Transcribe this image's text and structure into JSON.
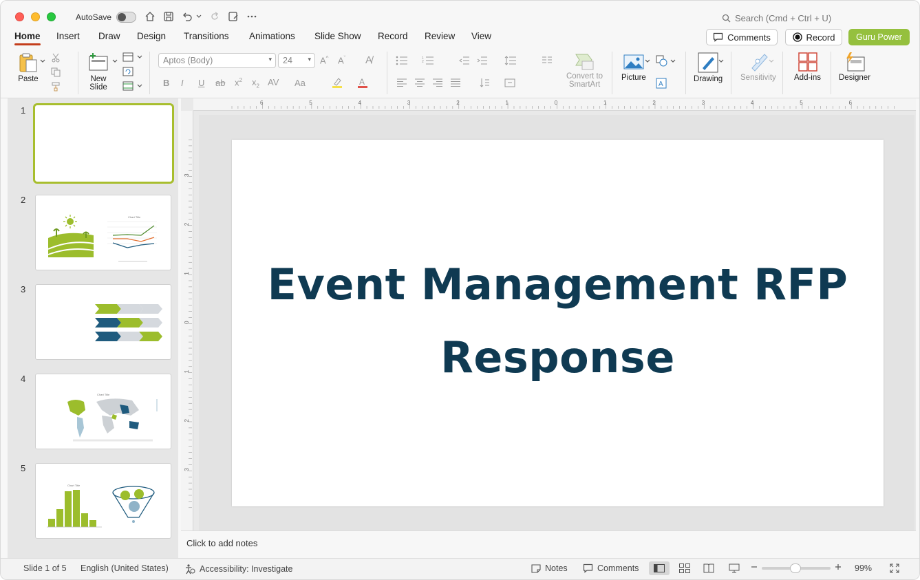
{
  "titlebar": {
    "autosave_label": "AutoSave",
    "search_placeholder": "Search (Cmd + Ctrl + U)"
  },
  "tabs": [
    {
      "label": "Home",
      "active": true
    },
    {
      "label": "Insert"
    },
    {
      "label": "Draw"
    },
    {
      "label": "Design"
    },
    {
      "label": "Transitions"
    },
    {
      "label": "Animations"
    },
    {
      "label": "Slide Show"
    },
    {
      "label": "Record"
    },
    {
      "label": "Review"
    },
    {
      "label": "View"
    }
  ],
  "header_buttons": {
    "comments": "Comments",
    "record": "Record",
    "guru": "Guru Power"
  },
  "ribbon": {
    "paste": "Paste",
    "new_slide": "New\nSlide",
    "font_name": "Aptos (Body)",
    "font_size": "24",
    "convert_smartart": "Convert to\nSmartArt",
    "picture": "Picture",
    "drawing": "Drawing",
    "sensitivity": "Sensitivity",
    "addins": "Add-ins",
    "designer": "Designer"
  },
  "slides": [
    {
      "number": "1"
    },
    {
      "number": "2"
    },
    {
      "number": "3"
    },
    {
      "number": "4"
    },
    {
      "number": "5"
    }
  ],
  "current_slide": {
    "title_line1": "Event Management RFP",
    "title_line2": "Response"
  },
  "notes_placeholder": "Click to add notes",
  "statusbar": {
    "slide_info": "Slide 1 of 5",
    "language": "English (United States)",
    "accessibility": "Accessibility: Investigate",
    "notes": "Notes",
    "comments": "Comments",
    "zoom": "99%"
  },
  "ruler": {
    "h_labels": [
      "6",
      "5",
      "4",
      "3",
      "2",
      "1",
      "0",
      "1",
      "2",
      "3",
      "4",
      "5",
      "6"
    ],
    "v_labels": [
      "3",
      "2",
      "1",
      "0",
      "1",
      "2",
      "3"
    ]
  },
  "colors": {
    "accent_tab": "#c43e1c",
    "guru": "#95c03e",
    "title_text": "#0f3a52",
    "thumb_green": "#9cbd2c",
    "thumb_navy": "#1f5b7e"
  }
}
